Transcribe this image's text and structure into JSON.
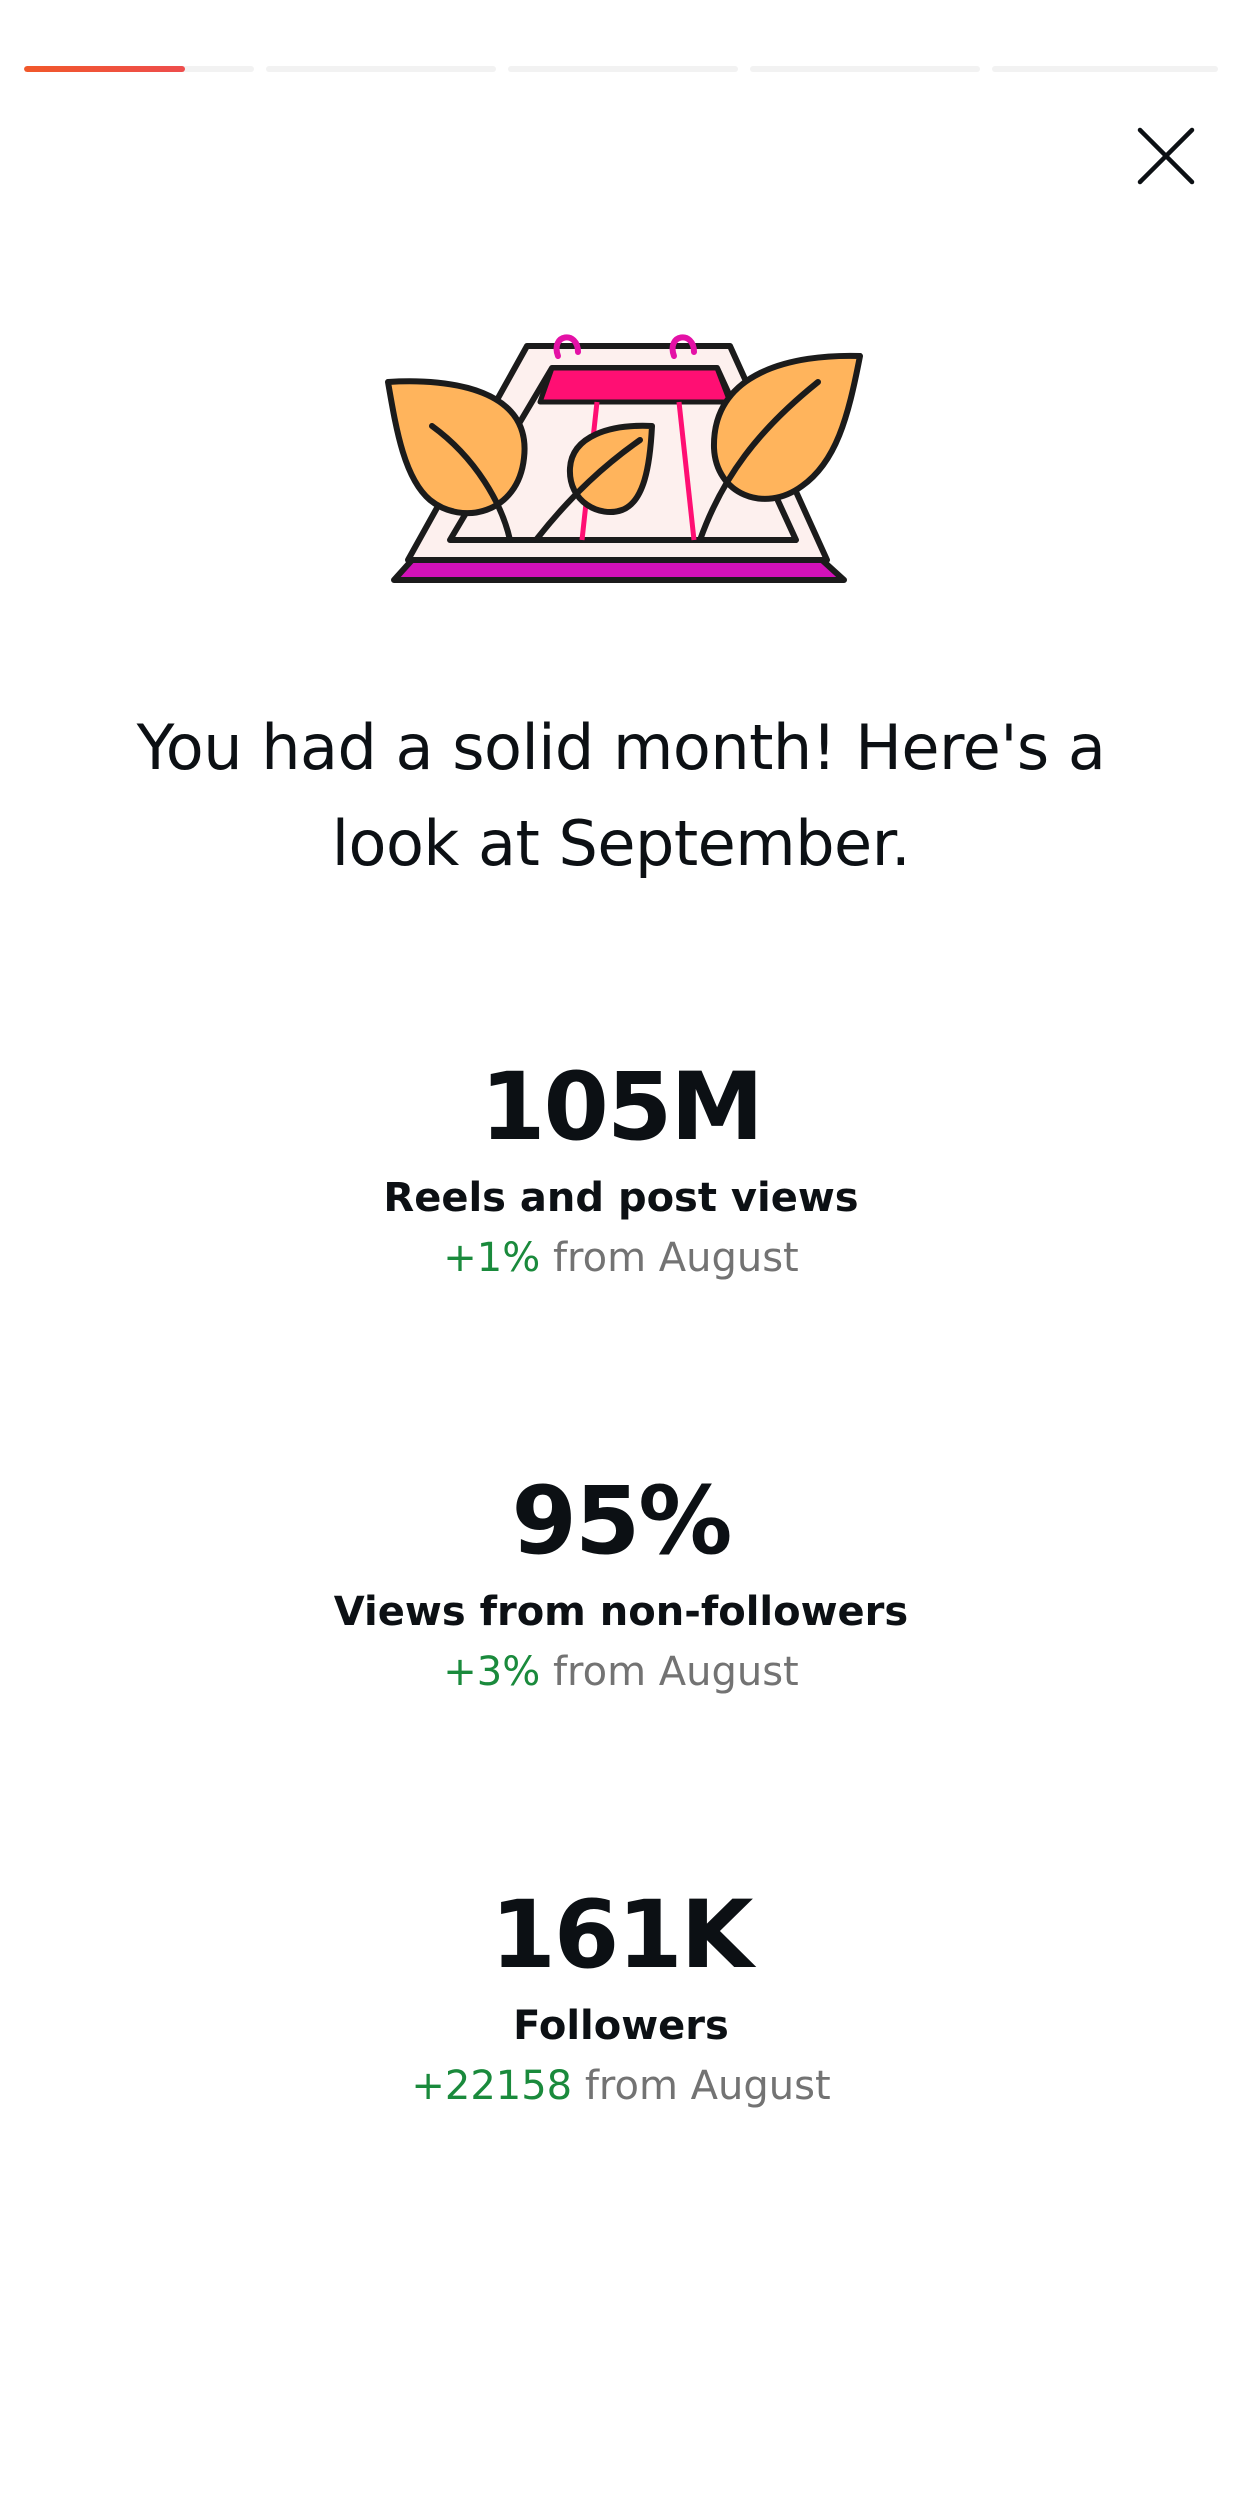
{
  "progress": {
    "segments": 6,
    "active_index": 0,
    "active_fill": 0.7
  },
  "close": {
    "icon": "close-icon"
  },
  "illustration": {
    "icon": "calendar-leaves-illustration"
  },
  "headline": "You had a solid month! Here's a look at September.",
  "stats": [
    {
      "value": "105M",
      "label": "Reels and post views",
      "delta": "+1%",
      "suffix": "from August"
    },
    {
      "value": "95%",
      "label": "Views from non-followers",
      "delta": "+3%",
      "suffix": "from August"
    },
    {
      "value": "161K",
      "label": "Followers",
      "delta": "+22158",
      "suffix": "from August"
    }
  ],
  "colors": {
    "accent": "#f1582a",
    "positive": "#1a8a3c",
    "muted": "#737373",
    "text": "#0c1014"
  }
}
